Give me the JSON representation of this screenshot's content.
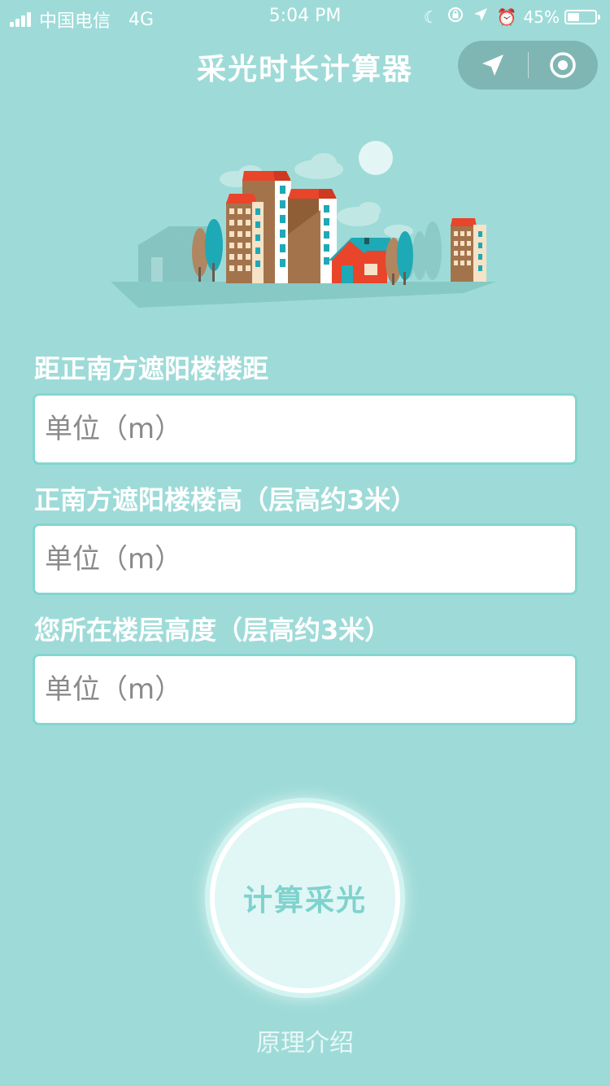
{
  "status_bar": {
    "carrier": "中国电信",
    "network": "4G",
    "time": "5:04 PM",
    "battery": "45%",
    "battery_level": 0.45,
    "icons": [
      "moon-icon",
      "orientation-lock-icon",
      "location-arrow-icon",
      "alarm-icon",
      "battery-icon"
    ]
  },
  "nav": {
    "title": "采光时长计算器",
    "capsule_left_icon": "location-arrow-icon",
    "capsule_right_icon": "target-icon"
  },
  "form": {
    "fields": [
      {
        "label": "距正南方遮阳楼楼距",
        "placeholder": "单位（m）",
        "value": ""
      },
      {
        "label": "正南方遮阳楼楼高（层高约3米）",
        "placeholder": "单位（m）",
        "value": ""
      },
      {
        "label": "您所在楼层高度（层高约3米）",
        "placeholder": "单位（m）",
        "value": ""
      }
    ]
  },
  "actions": {
    "calculate_label": "计算采光",
    "intro_link": "原理介绍"
  },
  "colors": {
    "background": "#9edbd8",
    "accent": "#7fd2cd",
    "field_border": "#82d6d0",
    "roof_red": "#e8452b"
  }
}
